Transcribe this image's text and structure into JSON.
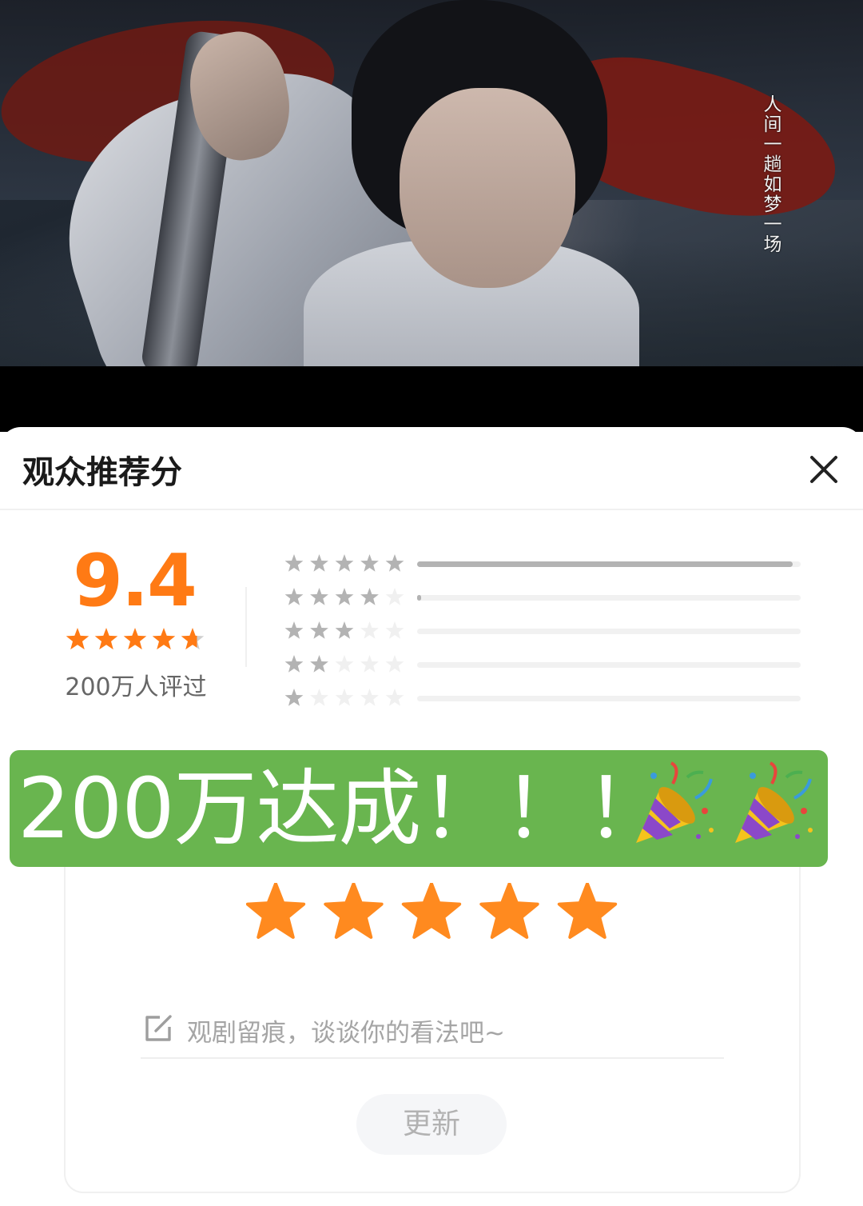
{
  "video": {
    "caption": "人间一趟如梦一场"
  },
  "sheet": {
    "title": "观众推荐分",
    "close_icon": "close-icon"
  },
  "score": {
    "value": "9.4",
    "star_fraction": 0.94,
    "rating_count": "200万人评过",
    "accent_color": "#ff7a14"
  },
  "distribution": [
    {
      "stars": 5,
      "share": 0.98
    },
    {
      "stars": 4,
      "share": 0.01
    },
    {
      "stars": 3,
      "share": 0.0
    },
    {
      "stars": 2,
      "share": 0.0
    },
    {
      "stars": 1,
      "share": 0.0
    }
  ],
  "banner": {
    "text": "200万达成！！！",
    "color": "#69b54f",
    "icons": [
      "party-popper-icon",
      "party-popper-icon"
    ]
  },
  "rate_form": {
    "selected_stars": 5,
    "max_stars": 5,
    "comment_placeholder": "观剧留痕，谈谈你的看法吧~",
    "submit_label": "更新"
  }
}
